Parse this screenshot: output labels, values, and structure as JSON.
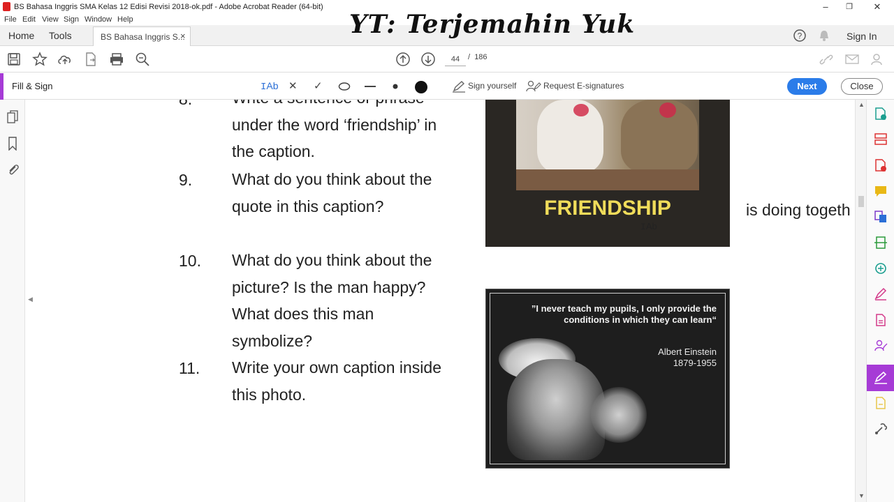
{
  "window": {
    "title": "BS Bahasa Inggris SMA Kelas 12 Edisi Revisi 2018-ok.pdf - Adobe Acrobat Reader (64-bit)",
    "minimize": "–",
    "maximize": "❐",
    "close": "✕"
  },
  "menu": [
    "File",
    "Edit",
    "View",
    "Sign",
    "Window",
    "Help"
  ],
  "tabs": {
    "home": "Home",
    "tools": "Tools",
    "document": "BS Bahasa Inggris S...",
    "document_close": "×"
  },
  "account": {
    "sign_in": "Sign In"
  },
  "watermark": "YT: Terjemahin Yuk",
  "toolbar": {
    "current_page": "44",
    "separator": "/",
    "total_pages": "186"
  },
  "fill_sign": {
    "label": "Fill & Sign",
    "text_tool": "Ab",
    "sign_yourself": "Sign yourself",
    "request_esign": "Request E-signatures",
    "next": "Next",
    "close": "Close"
  },
  "document": {
    "questions": [
      {
        "num": "8.",
        "lines": [
          "Write a sentence or phrase",
          "under the word ‘friendship’ in",
          "the caption."
        ]
      },
      {
        "num": "9.",
        "lines": [
          "What do you think about the",
          "quote in this caption?"
        ]
      },
      {
        "num": "10.",
        "lines": [
          "What do you think about the",
          "picture? Is the man happy?",
          "What does this man",
          "symbolize?"
        ]
      },
      {
        "num": "11.",
        "lines": [
          "Write your own caption inside",
          "this photo."
        ]
      }
    ],
    "friendship_caption": "FRIENDSHIP",
    "cursor_label": "Ab",
    "side_text": "is doing togeth",
    "einstein_quote": "”I never teach my pupils, I only provide the conditions in which they can learn“",
    "einstein_name": "Albert Einstein",
    "einstein_years": "1879-1955"
  }
}
